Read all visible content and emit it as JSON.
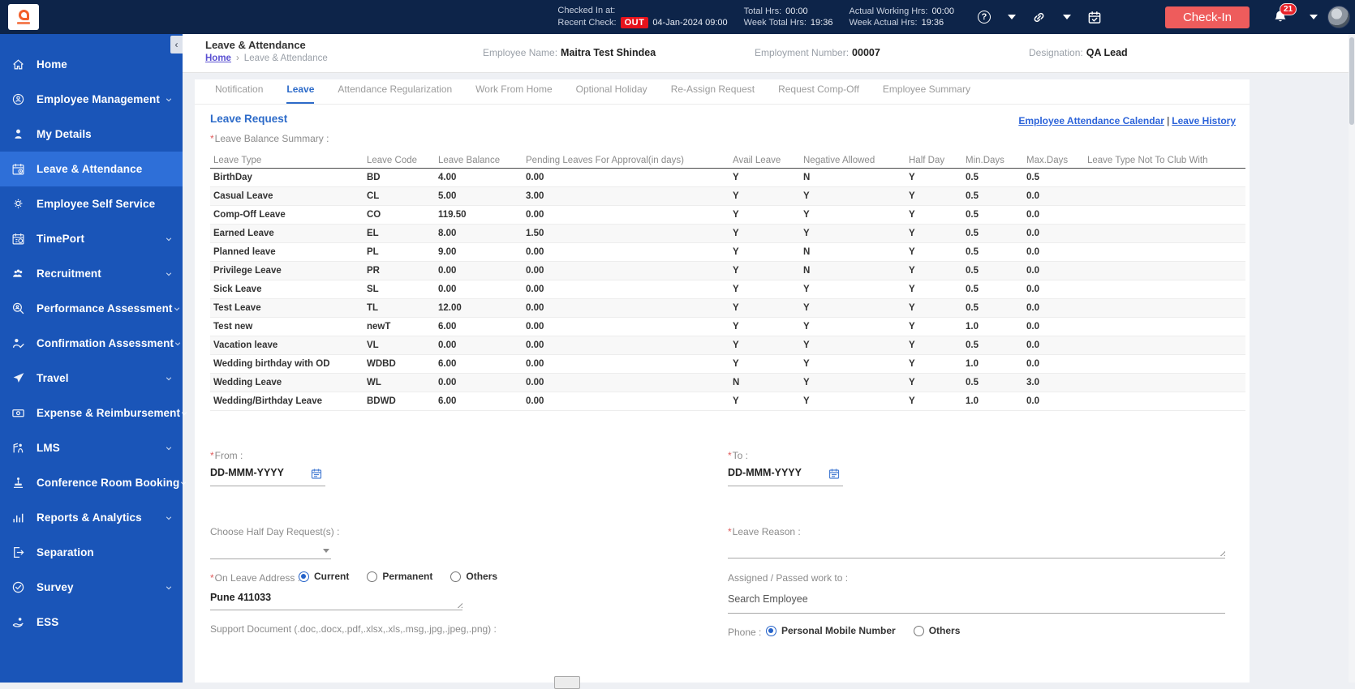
{
  "colors": {
    "topbar": "#0d2449",
    "sidebar": "#1a55b8",
    "sidebar_active": "#2e6fd8",
    "accent": "#2d6bc9",
    "checkin": "#ee5c5c",
    "out_badge": "#e8131c",
    "link": "#2c63d9",
    "breadcrumb_link": "#5a50d2"
  },
  "topbar": {
    "checked_in_label": "Checked In at:",
    "recent_check_label": "Recent Check:",
    "out_badge": "OUT",
    "recent_check_value": "04-Jan-2024 09:00",
    "total_hrs_label": "Total Hrs:",
    "total_hrs_value": "00:00",
    "week_total_label": "Week Total Hrs:",
    "week_total_value": "19:36",
    "actual_working_label": "Actual Working Hrs:",
    "actual_working_value": "00:00",
    "week_actual_label": "Week Actual Hrs:",
    "week_actual_value": "19:36",
    "help_icon": "?",
    "checkin_button": "Check-In",
    "notification_count": "21",
    "icons": [
      "help-icon",
      "chevron-down-icon",
      "link-icon",
      "chevron-down-icon",
      "attendance-calendar-icon",
      "bell-icon",
      "chevron-down-icon",
      "avatar"
    ]
  },
  "sidebar": {
    "collapse_glyph": "‹",
    "items": [
      {
        "label": "Home",
        "icon": "home-icon",
        "chevron": false,
        "active": false
      },
      {
        "label": "Employee Management",
        "icon": "employee-management-icon",
        "chevron": true,
        "active": false
      },
      {
        "label": "My Details",
        "icon": "my-details-icon",
        "chevron": false,
        "active": false
      },
      {
        "label": "Leave & Attendance",
        "icon": "leave-attendance-icon",
        "chevron": false,
        "active": true
      },
      {
        "label": "Employee Self Service",
        "icon": "employee-self-service-icon",
        "chevron": false,
        "active": false
      },
      {
        "label": "TimePort",
        "icon": "timeport-icon",
        "chevron": true,
        "active": false
      },
      {
        "label": "Recruitment",
        "icon": "recruitment-icon",
        "chevron": true,
        "active": false
      },
      {
        "label": "Performance Assessment",
        "icon": "performance-assessment-icon",
        "chevron": true,
        "active": false
      },
      {
        "label": "Confirmation Assessment",
        "icon": "confirmation-assessment-icon",
        "chevron": true,
        "active": false
      },
      {
        "label": "Travel",
        "icon": "travel-icon",
        "chevron": true,
        "active": false
      },
      {
        "label": "Expense & Reimbursement",
        "icon": "expense-icon",
        "chevron": true,
        "active": false
      },
      {
        "label": "LMS",
        "icon": "lms-icon",
        "chevron": true,
        "active": false
      },
      {
        "label": "Conference Room Booking",
        "icon": "conference-room-icon",
        "chevron": true,
        "active": false
      },
      {
        "label": "Reports & Analytics",
        "icon": "reports-analytics-icon",
        "chevron": true,
        "active": false
      },
      {
        "label": "Separation",
        "icon": "separation-icon",
        "chevron": false,
        "active": false
      },
      {
        "label": "Survey",
        "icon": "survey-icon",
        "chevron": true,
        "active": false
      },
      {
        "label": "ESS",
        "icon": "ess-icon",
        "chevron": false,
        "active": false
      }
    ]
  },
  "header": {
    "title": "Leave & Attendance",
    "breadcrumb": {
      "home": "Home",
      "separator": "›",
      "current": "Leave & Attendance"
    },
    "employee_name_label": "Employee Name:",
    "employee_name": "Maitra Test Shindea",
    "employment_number_label": "Employment Number:",
    "employment_number": "00007",
    "designation_label": "Designation:",
    "designation": "QA Lead"
  },
  "tabs": [
    {
      "label": "Notification"
    },
    {
      "label": "Leave"
    },
    {
      "label": "Attendance Regularization"
    },
    {
      "label": "Work From Home"
    },
    {
      "label": "Optional Holiday"
    },
    {
      "label": "Re-Assign Request"
    },
    {
      "label": "Request Comp-Off"
    },
    {
      "label": "Employee Summary"
    }
  ],
  "main": {
    "section_title": "Leave Request",
    "links": {
      "calendar": "Employee Attendance Calendar",
      "separator": "|",
      "history": "Leave History"
    },
    "required_marker": "*",
    "summary_label": "Leave Balance Summary :",
    "table": {
      "headers": [
        "Leave Type",
        "Leave Code",
        "Leave Balance",
        "Pending Leaves For Approval(in days)",
        "Avail Leave",
        "Negative Allowed",
        "Half Day",
        "Min.Days",
        "Max.Days",
        "Leave Type Not To Club With"
      ],
      "rows": [
        [
          "BirthDay",
          "BD",
          "4.00",
          "0.00",
          "Y",
          "N",
          "Y",
          "0.5",
          "0.5",
          ""
        ],
        [
          "Casual Leave",
          "CL",
          "5.00",
          "3.00",
          "Y",
          "Y",
          "Y",
          "0.5",
          "0.0",
          ""
        ],
        [
          "Comp-Off Leave",
          "CO",
          "119.50",
          "0.00",
          "Y",
          "Y",
          "Y",
          "0.5",
          "0.0",
          ""
        ],
        [
          "Earned Leave",
          "EL",
          "8.00",
          "1.50",
          "Y",
          "Y",
          "Y",
          "0.5",
          "0.0",
          ""
        ],
        [
          "Planned leave",
          "PL",
          "9.00",
          "0.00",
          "Y",
          "N",
          "Y",
          "0.5",
          "0.0",
          ""
        ],
        [
          "Privilege Leave",
          "PR",
          "0.00",
          "0.00",
          "Y",
          "N",
          "Y",
          "0.5",
          "0.0",
          ""
        ],
        [
          "Sick Leave",
          "SL",
          "0.00",
          "0.00",
          "Y",
          "Y",
          "Y",
          "0.5",
          "0.0",
          ""
        ],
        [
          "Test Leave",
          "TL",
          "12.00",
          "0.00",
          "Y",
          "Y",
          "Y",
          "0.5",
          "0.0",
          ""
        ],
        [
          "Test new",
          "newT",
          "6.00",
          "0.00",
          "Y",
          "Y",
          "Y",
          "1.0",
          "0.0",
          ""
        ],
        [
          "Vacation leave",
          "VL",
          "0.00",
          "0.00",
          "Y",
          "Y",
          "Y",
          "0.5",
          "0.0",
          ""
        ],
        [
          "Wedding birthday with OD",
          "WDBD",
          "6.00",
          "0.00",
          "Y",
          "Y",
          "Y",
          "1.0",
          "0.0",
          ""
        ],
        [
          "Wedding Leave",
          "WL",
          "0.00",
          "0.00",
          "N",
          "Y",
          "Y",
          "0.5",
          "3.0",
          ""
        ],
        [
          "Wedding/Birthday Leave",
          "BDWD",
          "6.00",
          "0.00",
          "Y",
          "Y",
          "Y",
          "1.0",
          "0.0",
          ""
        ]
      ]
    },
    "form": {
      "from_label": "From :",
      "to_label": "To :",
      "date_placeholder": "DD-MMM-YYYY",
      "half_day_label": "Choose Half Day Request(s) :",
      "leave_reason_label": "Leave Reason :",
      "on_leave_address_label": "On Leave Address :",
      "address_options": [
        "Current",
        "Permanent",
        "Others"
      ],
      "address_selected": "Current",
      "address_value": "Pune 411033",
      "assigned_label": "Assigned / Passed work to :",
      "search_placeholder": "Search Employee",
      "support_label": "Support Document (.doc,.docx,.pdf,.xlsx,.xls,.msg,.jpg,.jpeg,.png) :",
      "phone_label": "Phone :",
      "phone_options": [
        "Personal Mobile Number",
        "Others"
      ],
      "phone_selected": "Personal Mobile Number"
    }
  }
}
